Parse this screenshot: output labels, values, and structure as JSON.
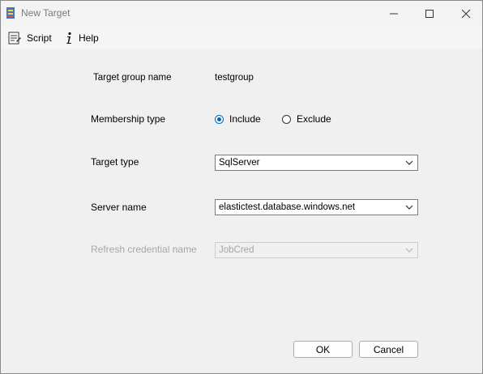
{
  "window": {
    "title": "New Target",
    "controls": {
      "minimize": "minimize",
      "maximize": "maximize",
      "close": "close"
    }
  },
  "toolbar": {
    "script_label": "Script",
    "script_icon": "script-icon",
    "help_label": "Help",
    "help_icon": "info-icon"
  },
  "form": {
    "target_group_name_label": "Target group name",
    "target_group_name_value": "testgroup",
    "membership_type_label": "Membership type",
    "membership_options": [
      {
        "label": "Include",
        "checked": true
      },
      {
        "label": "Exclude",
        "checked": false
      }
    ],
    "target_type_label": "Target type",
    "target_type_value": "SqlServer",
    "server_name_label": "Server name",
    "server_name_value": "elastictest.database.windows.net",
    "refresh_credential_label": "Refresh credential name",
    "refresh_credential_value": "JobCred",
    "refresh_credential_enabled": false
  },
  "buttons": {
    "ok_label": "OK",
    "cancel_label": "Cancel"
  },
  "colors": {
    "accent": "#0067c0",
    "disabled_text": "#a6a6a6",
    "background": "#f0f0f0"
  }
}
